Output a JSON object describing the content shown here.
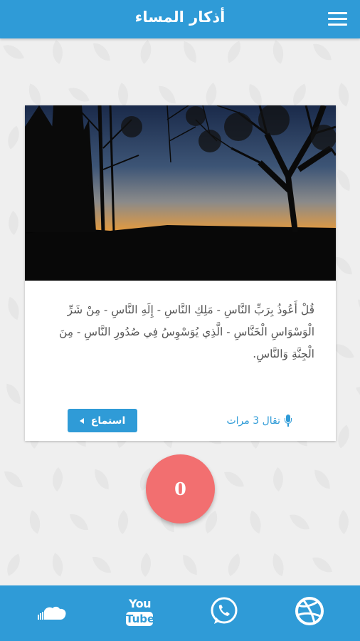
{
  "header": {
    "title": "أذكار المساء",
    "menu_icon": "hamburger-menu-icon"
  },
  "card": {
    "image": "sunset-forest-photo",
    "text": "قُلْ أَعُوذُ بِرَبِّ النَّاسِ - مَلِكِ النَّاسِ - إِلَهِ النَّاسِ - مِنْ شَرِّ الْوَسْوَاسِ الْخَنَّاسِ - الَّذِي يُوَسْوِسُ فِي صُدُورِ النَّاسِ - مِنَ الْجِنَّةِ وَالنَّاسِ.",
    "listen_label": "استماع",
    "repeat_label": "تقال 3 مرات"
  },
  "counter": {
    "value": "0"
  },
  "bottom_nav": {
    "items": [
      {
        "icon": "soundcloud-icon"
      },
      {
        "icon": "youtube-icon",
        "you": "You",
        "tube": "Tube"
      },
      {
        "icon": "whatsapp-icon"
      },
      {
        "icon": "dribbble-icon"
      }
    ]
  },
  "colors": {
    "primary": "#2f9bd7",
    "counter": "#f26f70",
    "background": "#efefef"
  }
}
